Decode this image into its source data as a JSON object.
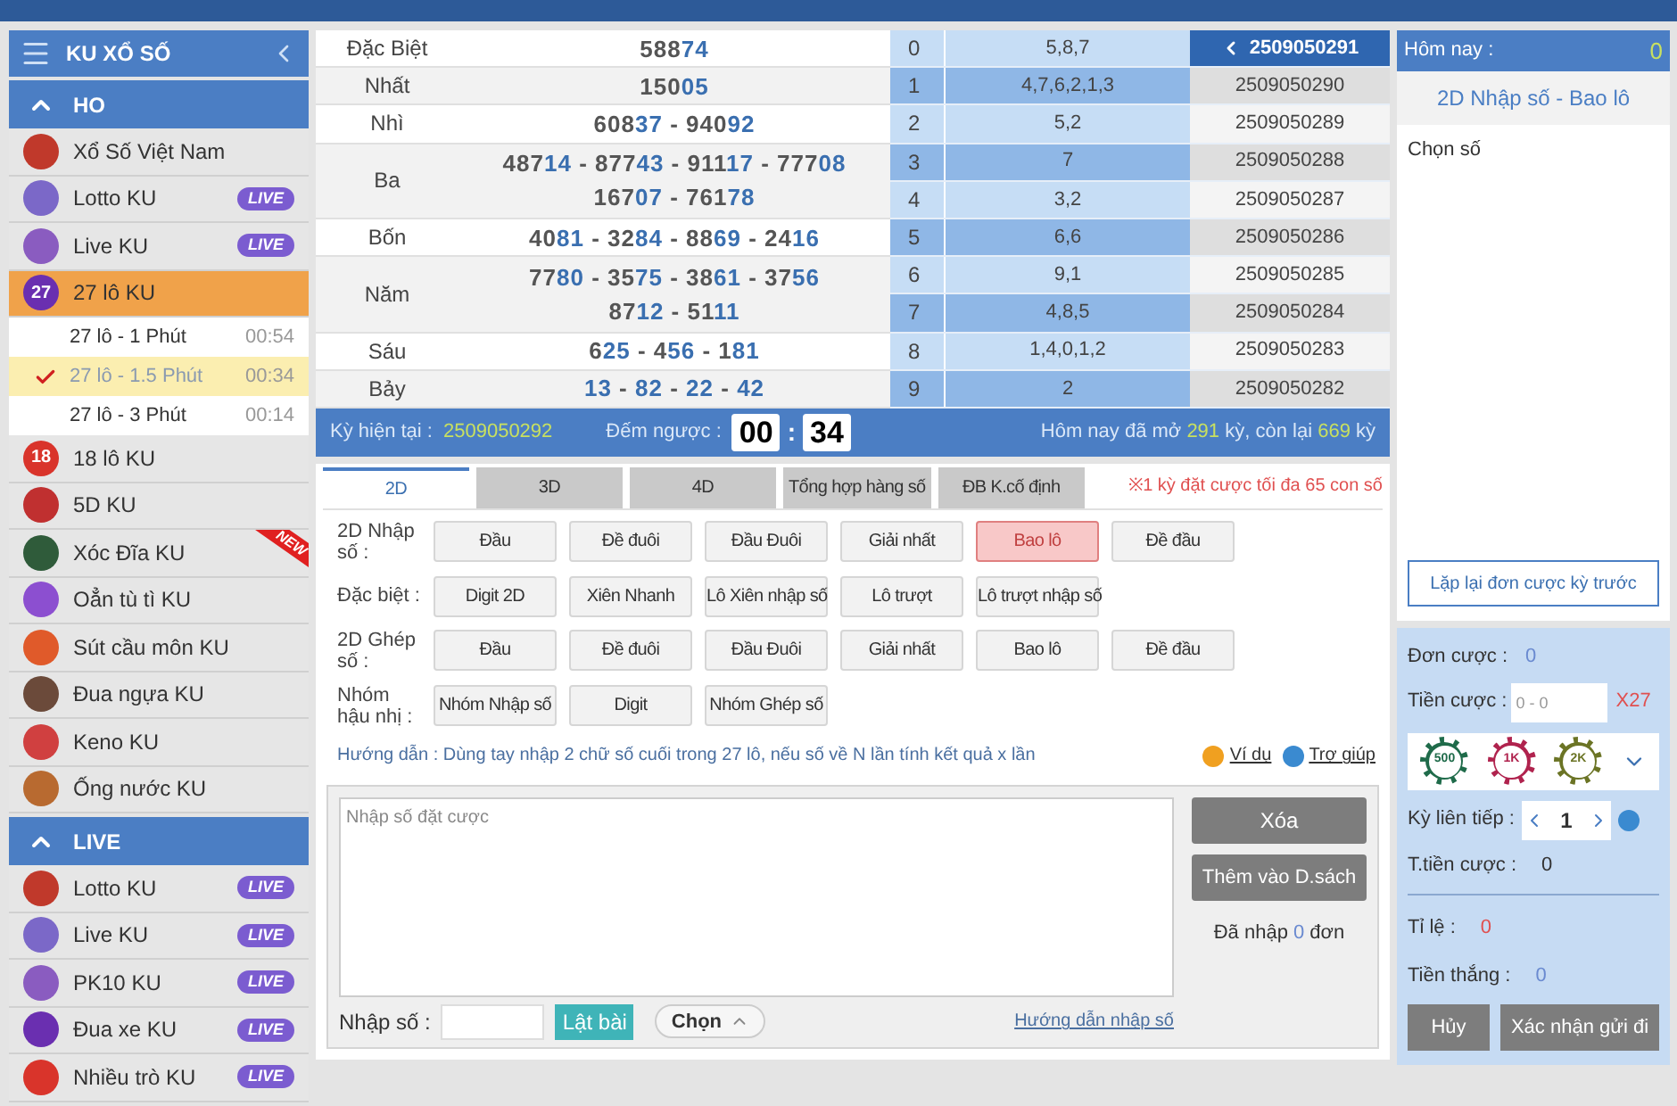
{
  "sidebar": {
    "title": "KU XỔ SỐ",
    "sections": [
      {
        "title": "HO",
        "expanded": true,
        "items": [
          {
            "label": "Xổ Số Việt Nam",
            "selected": false
          },
          {
            "label": "Lotto KU",
            "badge": "LIVE",
            "selected": false
          },
          {
            "label": "Live KU",
            "badge": "LIVE",
            "selected": false
          },
          {
            "label": "27 lô KU",
            "icon_text": "27",
            "selected": true,
            "children": [
              {
                "label": "27 lô - 1 Phút",
                "time": "00:54",
                "selected": false
              },
              {
                "label": "27 lô - 1.5 Phút",
                "time": "00:34",
                "selected": true
              },
              {
                "label": "27 lô - 3 Phút",
                "time": "00:14",
                "selected": false
              }
            ]
          },
          {
            "label": "18 lô KU",
            "icon_text": "18",
            "selected": false
          },
          {
            "label": "5D KU",
            "selected": false
          },
          {
            "label": "Xóc Đĩa KU",
            "ribbon": "NEW",
            "selected": false
          },
          {
            "label": "Oẳn tù tì KU",
            "selected": false
          },
          {
            "label": "Sút cầu môn KU",
            "selected": false
          },
          {
            "label": "Đua ngựa KU",
            "selected": false
          },
          {
            "label": "Keno KU",
            "selected": false
          },
          {
            "label": "Ống nước KU",
            "selected": false
          }
        ]
      },
      {
        "title": "LIVE",
        "expanded": true,
        "items": [
          {
            "label": "Lotto KU",
            "badge": "LIVE",
            "selected": false
          },
          {
            "label": "Live KU",
            "badge": "LIVE",
            "selected": false
          },
          {
            "label": "PK10 KU",
            "badge": "LIVE",
            "selected": false
          },
          {
            "label": "Đua xe KU",
            "badge": "LIVE",
            "selected": false
          },
          {
            "label": "Nhiều trò KU",
            "badge": "LIVE",
            "selected": false
          }
        ]
      }
    ]
  },
  "results": {
    "prizes": [
      {
        "name": "Đặc Biệt",
        "lines": [
          "58874"
        ]
      },
      {
        "name": "Nhất",
        "lines": [
          "15005"
        ]
      },
      {
        "name": "Nhì",
        "lines": [
          "60837 - 94092"
        ]
      },
      {
        "name": "Ba",
        "lines": [
          "48714 - 87743 - 91117 - 77708",
          "16707 - 76178"
        ]
      },
      {
        "name": "Bốn",
        "lines": [
          "4081 - 3284 - 8869 - 2416"
        ]
      },
      {
        "name": "Năm",
        "lines": [
          "7780 - 3575 - 3861 - 3756",
          "8712 - 5111"
        ]
      },
      {
        "name": "Sáu",
        "lines": [
          "625 - 456 - 181"
        ]
      },
      {
        "name": "Bảy",
        "lines": [
          "13 - 82 - 22 - 42"
        ]
      }
    ],
    "history": [
      {
        "digit": "0",
        "values": "5,8,7",
        "period": "2509050291",
        "selected": true
      },
      {
        "digit": "1",
        "values": "4,7,6,2,1,3",
        "period": "2509050290",
        "selected": false
      },
      {
        "digit": "2",
        "values": "5,2",
        "period": "2509050289",
        "selected": false
      },
      {
        "digit": "3",
        "values": "7",
        "period": "2509050288",
        "selected": false
      },
      {
        "digit": "4",
        "values": "3,2",
        "period": "2509050287",
        "selected": false
      },
      {
        "digit": "5",
        "values": "6,6",
        "period": "2509050286",
        "selected": false
      },
      {
        "digit": "6",
        "values": "9,1",
        "period": "2509050285",
        "selected": false
      },
      {
        "digit": "7",
        "values": "4,8,5",
        "period": "2509050284",
        "selected": false
      },
      {
        "digit": "8",
        "values": "1,4,0,1,2",
        "period": "2509050283",
        "selected": false
      },
      {
        "digit": "9",
        "values": "2",
        "period": "2509050282",
        "selected": false
      }
    ]
  },
  "status": {
    "current_label": "Kỳ hiện tại :",
    "current": "2509050292",
    "countdown_label": "Đếm ngược :",
    "minutes": "00",
    "separator": ":",
    "seconds": "34",
    "summary": [
      {
        "text": "Hôm nay đã mở ",
        "highlight": false
      },
      {
        "text": "291",
        "highlight": true
      },
      {
        "text": " kỳ, còn lại ",
        "highlight": false
      },
      {
        "text": "669",
        "highlight": true
      },
      {
        "text": " kỳ",
        "highlight": false
      }
    ]
  },
  "bet_tabs": [
    {
      "label": "2D",
      "selected": true
    },
    {
      "label": "3D",
      "selected": false
    },
    {
      "label": "4D",
      "selected": false
    },
    {
      "label": "Tổng hợp hàng số",
      "selected": false
    },
    {
      "label": "ĐB K.cố định",
      "selected": false
    }
  ],
  "limit_note": "※1 kỳ đặt cược tối đa 65 con số",
  "bet_groups": [
    {
      "label": "2D Nhập số :",
      "options": [
        {
          "label": "Đầu",
          "selected": false
        },
        {
          "label": "Đề đuôi",
          "selected": false
        },
        {
          "label": "Đầu Đuôi",
          "selected": false
        },
        {
          "label": "Giải nhất",
          "selected": false
        },
        {
          "label": "Bao lô",
          "selected": true
        },
        {
          "label": "Đề đầu",
          "selected": false
        }
      ]
    },
    {
      "label": "Đặc biệt :",
      "options": [
        {
          "label": "Digit 2D",
          "selected": false
        },
        {
          "label": "Xiên Nhanh",
          "selected": false
        },
        {
          "label": "Lô Xiên nhập số",
          "selected": false
        },
        {
          "label": "Lô trượt",
          "selected": false
        },
        {
          "label": "Lô trượt nhập số",
          "selected": false
        }
      ]
    },
    {
      "label": "2D Ghép số :",
      "options": [
        {
          "label": "Đầu",
          "selected": false
        },
        {
          "label": "Đề đuôi",
          "selected": false
        },
        {
          "label": "Đầu Đuôi",
          "selected": false
        },
        {
          "label": "Giải nhất",
          "selected": false
        },
        {
          "label": "Bao lô",
          "selected": false
        },
        {
          "label": "Đề đầu",
          "selected": false
        }
      ]
    },
    {
      "label": "Nhóm hậu nhị :",
      "options": [
        {
          "label": "Nhóm Nhập số",
          "selected": false
        },
        {
          "label": "Digit",
          "selected": false
        },
        {
          "label": "Nhóm Ghép số",
          "selected": false
        }
      ]
    }
  ],
  "guide": "Hướng dẫn : Dùng tay nhập 2 chữ số cuối trong 27 lô, nếu số về N lần tính kết quả x lần",
  "example_link": "Ví dụ",
  "help_link": "Trợ giúp",
  "entry": {
    "placeholder": "Nhập số đặt cược",
    "clear": "Xóa",
    "add": "Thêm vào D.sách",
    "count": [
      {
        "text": "Đã nhập ",
        "highlight": false
      },
      {
        "text": "0",
        "highlight": true
      },
      {
        "text": " đơn",
        "highlight": false
      }
    ],
    "number_label": "Nhập số :",
    "flip": "Lật bài",
    "choose": "Chọn",
    "guide_link": "Hướng dẫn nhập số"
  },
  "slip": {
    "today_label": "Hôm nay :",
    "today": "0",
    "mode": "2D Nhập số - Bao lô",
    "choose": "Chọn số",
    "repeat": "Lặp lại đơn cược kỳ trước",
    "orders_label": "Đơn cược :",
    "orders": "0",
    "stake_label": "Tiền cược :",
    "stake_placeholder": "0 - 0",
    "multiplier": "X27",
    "chips": [
      {
        "label": "500",
        "color": "#1f6b4a"
      },
      {
        "label": "1K",
        "color": "#b0234e"
      },
      {
        "label": "2K",
        "color": "#6b7425"
      }
    ],
    "periods_label": "Kỳ liên tiếp :",
    "periods": "1",
    "total_label": "T.tiền cược :",
    "total": "0",
    "odds_label": "Tỉ lệ :",
    "odds": "0",
    "win_label": "Tiền thắng :",
    "win": "0",
    "cancel": "Hủy",
    "confirm": "Xác nhận gửi đi"
  }
}
